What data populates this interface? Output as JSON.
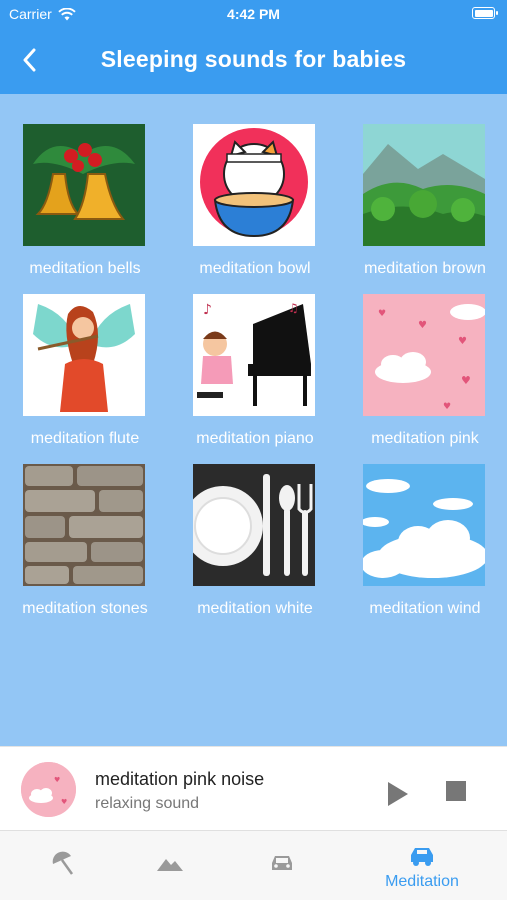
{
  "status": {
    "carrier": "Carrier",
    "time": "4:42 PM"
  },
  "header": {
    "title": "Sleeping sounds for babies"
  },
  "sounds": [
    {
      "label": "meditation bells"
    },
    {
      "label": "meditation bowl"
    },
    {
      "label": "meditation brown"
    },
    {
      "label": "meditation flute"
    },
    {
      "label": "meditation piano"
    },
    {
      "label": "meditation pink"
    },
    {
      "label": "meditation stones"
    },
    {
      "label": "meditation white"
    },
    {
      "label": "meditation wind"
    }
  ],
  "player": {
    "title": "meditation pink noise",
    "subtitle": "relaxing sound"
  },
  "tabs": [
    {
      "icon": "beach-umbrella-icon",
      "label": ""
    },
    {
      "icon": "mountains-icon",
      "label": ""
    },
    {
      "icon": "car-icon",
      "label": ""
    },
    {
      "icon": "car-active-icon",
      "label": "Meditation"
    }
  ],
  "colors": {
    "header": "#3a9cf0",
    "background": "#93c6f5",
    "accent": "#3a9cf0"
  }
}
